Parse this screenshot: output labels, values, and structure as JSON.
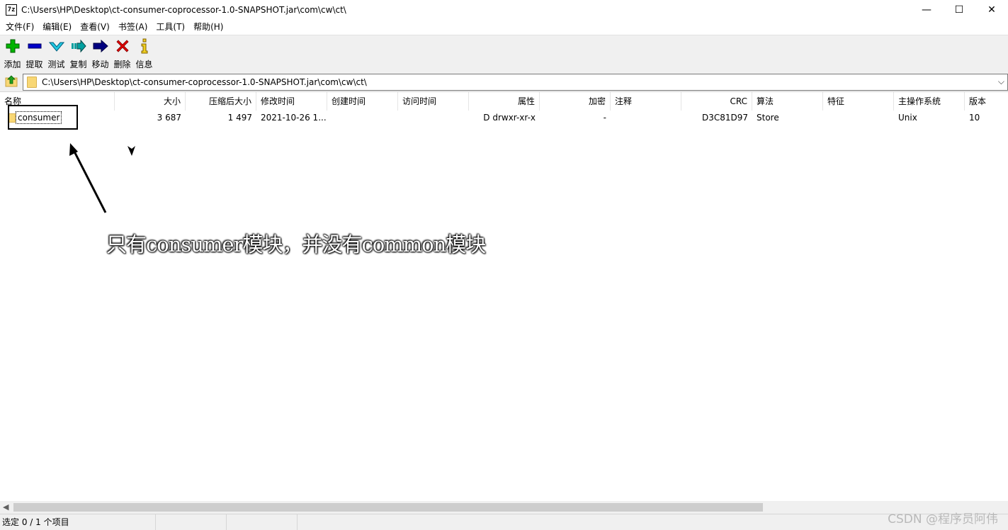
{
  "window": {
    "app_icon": "7z",
    "title": "C:\\Users\\HP\\Desktop\\ct-consumer-coprocessor-1.0-SNAPSHOT.jar\\com\\cw\\ct\\",
    "minimize": "—",
    "maximize": "☐",
    "close": "✕"
  },
  "menu": [
    "文件(F)",
    "编辑(E)",
    "查看(V)",
    "书签(A)",
    "工具(T)",
    "帮助(H)"
  ],
  "toolbar": [
    {
      "label": "添加",
      "icon": "add-icon",
      "color": "#00b400"
    },
    {
      "label": "提取",
      "icon": "extract-icon",
      "color": "#0000c8"
    },
    {
      "label": "测试",
      "icon": "test-icon",
      "color": "#00a0c0"
    },
    {
      "label": "复制",
      "icon": "copy-icon",
      "color": "#008c96"
    },
    {
      "label": "移动",
      "icon": "move-icon",
      "color": "#000080"
    },
    {
      "label": "删除",
      "icon": "delete-icon",
      "color": "#e00000"
    },
    {
      "label": "信息",
      "icon": "info-icon",
      "color": "#c8a000"
    }
  ],
  "address": {
    "path": "C:\\Users\\HP\\Desktop\\ct-consumer-coprocessor-1.0-SNAPSHOT.jar\\com\\cw\\ct\\",
    "dropdown": "⌵"
  },
  "columns": [
    "名称",
    "大小",
    "压缩后大小",
    "修改时间",
    "创建时间",
    "访问时间",
    "属性",
    "加密",
    "注释",
    "CRC",
    "算法",
    "特征",
    "主操作系统",
    "版本"
  ],
  "rows": [
    {
      "name": "consumer",
      "size": "3 687",
      "packed": "1 497",
      "modified": "2021-10-26 1...",
      "created": "",
      "accessed": "",
      "attributes": "D drwxr-xr-x",
      "encrypted": "-",
      "comment": "",
      "crc": "D3C81D97",
      "method": "Store",
      "characteristics": "",
      "host_os": "Unix",
      "version": "10"
    }
  ],
  "annotation": "只有consumer模块，并没有common模块",
  "status": {
    "selected": "选定 0 / 1 个项目"
  },
  "watermark": "CSDN @程序员阿伟",
  "scroll_left": "◀"
}
